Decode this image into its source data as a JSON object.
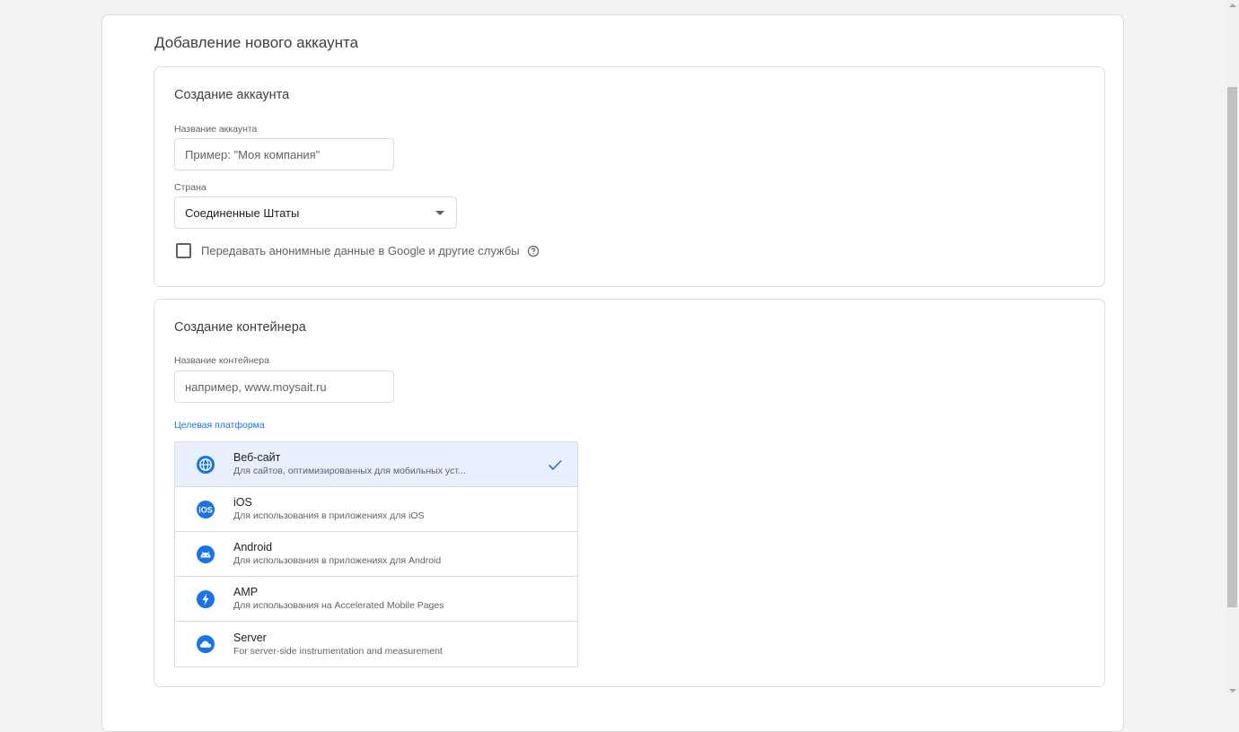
{
  "page_title": "Добавление нового аккаунта",
  "account_section": {
    "title": "Создание аккаунта",
    "account_name_label": "Название аккаунта",
    "account_name_placeholder": "Пример: \"Моя компания\"",
    "country_label": "Страна",
    "country_value": "Соединенные Штаты",
    "share_data_label": "Передавать анонимные данные в Google и другие службы",
    "share_data_checked": false
  },
  "container_section": {
    "title": "Создание контейнера",
    "container_name_label": "Название контейнера",
    "container_name_placeholder": "например, www.moysait.ru",
    "platform_label": "Целевая платформа",
    "platforms": [
      {
        "name": "Веб-сайт",
        "description": "Для сайтов, оптимизированных для мобильных уст...",
        "icon": "globe-icon",
        "selected": true
      },
      {
        "name": "iOS",
        "description": "Для использования в приложениях для iOS",
        "icon": "ios-icon",
        "selected": false
      },
      {
        "name": "Android",
        "description": "Для использования в приложениях для Android",
        "icon": "android-icon",
        "selected": false
      },
      {
        "name": "AMP",
        "description": "Для использования на Accelerated Mobile Pages",
        "icon": "amp-bolt-icon",
        "selected": false
      },
      {
        "name": "Server",
        "description": "For server-side instrumentation and measurement",
        "icon": "cloud-icon",
        "selected": false
      }
    ]
  },
  "colors": {
    "accent": "#1a73e8",
    "selected_bg": "#e8f0fe",
    "border": "#dadce0",
    "page_bg": "#f1f3f4"
  }
}
